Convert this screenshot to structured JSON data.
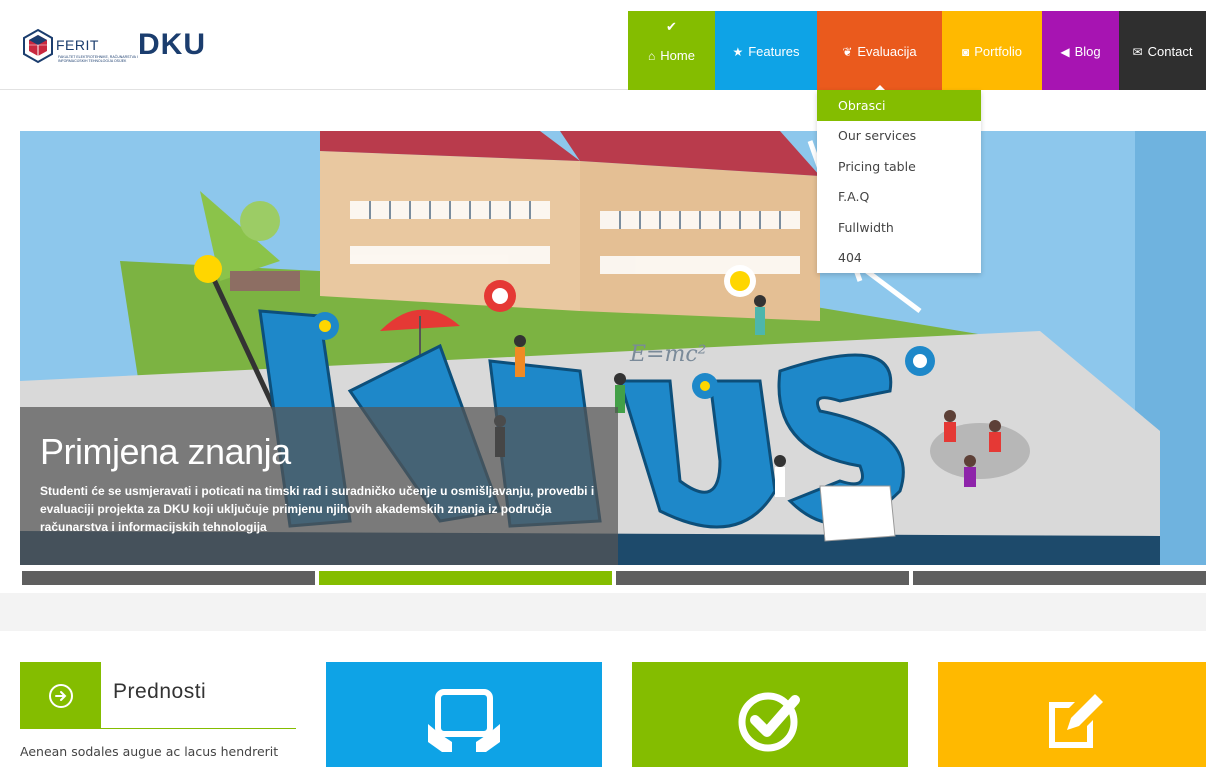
{
  "brand": {
    "ferit_label": "FERIT",
    "ferit_subtitle": "FAKULTET ELEKTROTEHNIKE, RAČUNARSTVA I INFORMACIJSKIH TEHNOLOGIJA OSIJEK",
    "dku_label": "DKU"
  },
  "nav": {
    "items": [
      {
        "label": "Home",
        "color": "#84bd00",
        "icon": "home-icon"
      },
      {
        "label": "Features",
        "color": "#0ea3e6",
        "icon": "star-icon"
      },
      {
        "label": "Evaluacija",
        "color": "#ea5a1d",
        "icon": "leaf-icon"
      },
      {
        "label": "Portfolio",
        "color": "#ffb900",
        "icon": "camera-icon"
      },
      {
        "label": "Blog",
        "color": "#a714b2",
        "icon": "megaphone-icon"
      },
      {
        "label": "Contact",
        "color": "#2f2f2f",
        "icon": "envelope-icon"
      }
    ]
  },
  "dropdown": {
    "items": [
      "Obrasci",
      "Our services",
      "Pricing table",
      "F.A.Q",
      "Fullwidth",
      "404"
    ],
    "active_color": "#84bd00"
  },
  "hero": {
    "title": "Primjena znanja",
    "text": "Studenti će se usmjeravati i poticati na timski rad i suradničko učenje u osmišljavanju, provedbi i evaluaciji projekta za DKU koji uključuje primjenu njihovih akademskih znanja iz područja računarstva i informacijskih tehnologija",
    "formula": "E=mc²",
    "letters": "LABUS",
    "pager": {
      "count": 4,
      "active_index": 1
    }
  },
  "features": {
    "prednosti": {
      "title": "Prednosti",
      "text": "Aenean sodales augue ac lacus hendrerit",
      "icon": "arrow-circle-icon"
    },
    "boxes": [
      {
        "icon": "tablet-icon",
        "color": "#0ea3e6"
      },
      {
        "icon": "check-circle-icon",
        "color": "#84bd00"
      },
      {
        "icon": "edit-icon",
        "color": "#ffb900"
      }
    ]
  }
}
